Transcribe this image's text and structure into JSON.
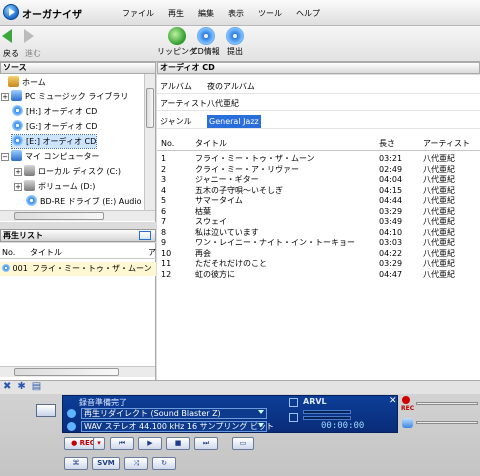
{
  "app": {
    "title": "オーガナイザ"
  },
  "menu": [
    "ファイル",
    "再生",
    "編集",
    "表示",
    "ツール",
    "ヘルプ"
  ],
  "toolbar": {
    "back": "戻る",
    "forward": "進む",
    "rip": "リッピング",
    "cdinfo": "CD情報",
    "submit": "提出"
  },
  "source_panel": {
    "title": "ソース"
  },
  "tree": [
    {
      "label": "ホーム",
      "icon": "home-icon"
    },
    {
      "label": "PC ミュージック ライブラリ",
      "icon": "pc-music-library-icon"
    },
    {
      "label": "[H:] オーディオ CD",
      "icon": "audio-cd-icon"
    },
    {
      "label": "[G:] オーディオ CD",
      "icon": "audio-cd-icon"
    },
    {
      "label": "[E:] オーディオ CD",
      "icon": "audio-cd-icon"
    },
    {
      "label": "マイ コンピューター",
      "icon": "computer-icon"
    },
    {
      "label": "ローカル ディスク (C:)",
      "icon": "local-disk-icon"
    },
    {
      "label": "ボリューム (D:)",
      "icon": "volume-icon"
    },
    {
      "label": "BD-RE ドライブ (E:) Audio",
      "icon": "bd-drive-icon"
    }
  ],
  "playlist_panel": {
    "title": "再生リスト",
    "col_no": "No.",
    "col_title": "タイトル",
    "col_artist_cut": "ア",
    "rows": [
      {
        "no": "001",
        "title": "フライ・ミー・トゥ・ザ・ムーン"
      }
    ]
  },
  "cd_panel": {
    "title": "オーディオ CD",
    "album_label": "アルバム",
    "album": "夜のアルバム",
    "artist_label": "アーティスト",
    "artist": "八代亜紀",
    "genre_label": "ジャンル",
    "genre": "General Jazz",
    "col_no": "No.",
    "col_title": "タイトル",
    "col_length": "長さ",
    "col_artist": "アーティスト",
    "tracks": [
      {
        "no": "1",
        "title": "フライ・ミー・トゥ・ザ・ムーン",
        "length": "03:21",
        "artist": "八代亜紀"
      },
      {
        "no": "2",
        "title": "クライ・ミー・ア・リヴァー",
        "length": "02:49",
        "artist": "八代亜紀"
      },
      {
        "no": "3",
        "title": "ジャニー・ギター",
        "length": "04:04",
        "artist": "八代亜紀"
      },
      {
        "no": "4",
        "title": "五木の子守唄～いそしぎ",
        "length": "04:15",
        "artist": "八代亜紀"
      },
      {
        "no": "5",
        "title": "サマータイム",
        "length": "04:44",
        "artist": "八代亜紀"
      },
      {
        "no": "6",
        "title": "枯葉",
        "length": "03:29",
        "artist": "八代亜紀"
      },
      {
        "no": "7",
        "title": "スウェイ",
        "length": "03:49",
        "artist": "八代亜紀"
      },
      {
        "no": "8",
        "title": "私は泣いています",
        "length": "04:10",
        "artist": "八代亜紀"
      },
      {
        "no": "9",
        "title": "ワン・レイニー・ナイト・イン・トーキョー",
        "length": "03:03",
        "artist": "八代亜紀"
      },
      {
        "no": "10",
        "title": "再会",
        "length": "04:22",
        "artist": "八代亜紀"
      },
      {
        "no": "11",
        "title": "ただそれだけのこと",
        "length": "03:29",
        "artist": "八代亜紀"
      },
      {
        "no": "12",
        "title": "虹の彼方に",
        "length": "04:47",
        "artist": "八代亜紀"
      }
    ]
  },
  "player": {
    "status": "録音準備完了",
    "device": "再生リダイレクト (Sound Blaster Z)",
    "format": "WAV ステレオ 44.100 kHz 16 サンプリング ビット",
    "arvl": "ARVL",
    "time": "00:00:00",
    "rec": "REC",
    "svm": "SVM",
    "rec_tag": "REC"
  },
  "colors": {
    "accent": "#2a6edc",
    "player_panel": "#0c3e98",
    "playlist_highlight": "#fff6d2"
  }
}
